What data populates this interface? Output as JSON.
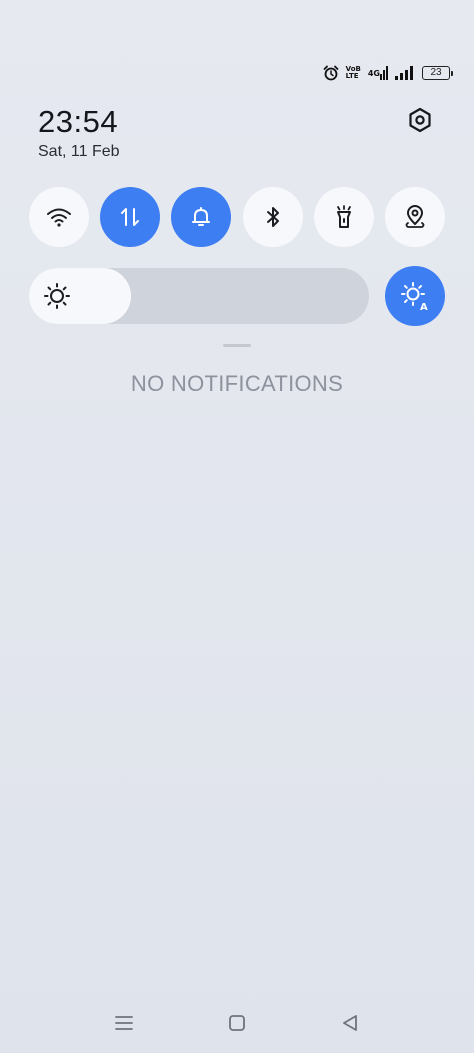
{
  "status_bar": {
    "alarm_icon": "alarm-clock-icon",
    "volte_top": "VoB",
    "volte_bottom": "LTE",
    "network": "4G",
    "signal_icon": "signal-bars-icon",
    "battery": "23"
  },
  "clock": {
    "time": "23:54",
    "date": "Sat, 11 Feb"
  },
  "settings_icon": "settings-hexagon-icon",
  "toggles": [
    {
      "name": "wifi",
      "icon": "wifi-icon",
      "active": false
    },
    {
      "name": "mobile-data",
      "icon": "data-arrows-icon",
      "active": true
    },
    {
      "name": "sound",
      "icon": "bell-icon",
      "active": true
    },
    {
      "name": "bluetooth",
      "icon": "bluetooth-icon",
      "active": false
    },
    {
      "name": "flashlight",
      "icon": "flashlight-icon",
      "active": false
    },
    {
      "name": "location",
      "icon": "location-pin-icon",
      "active": false
    }
  ],
  "brightness": {
    "level": 0.3,
    "icon": "sun-icon",
    "auto_icon": "auto-brightness-icon",
    "auto_active": true
  },
  "notifications": {
    "empty_text": "NO NOTIFICATIONS"
  },
  "colors": {
    "accent": "#3d7ef3",
    "toggle_off": "#f7f8fb",
    "background": "#e3e6ee"
  },
  "nav": {
    "recents_icon": "menu-lines-icon",
    "home_icon": "home-square-icon",
    "back_icon": "back-triangle-icon"
  }
}
